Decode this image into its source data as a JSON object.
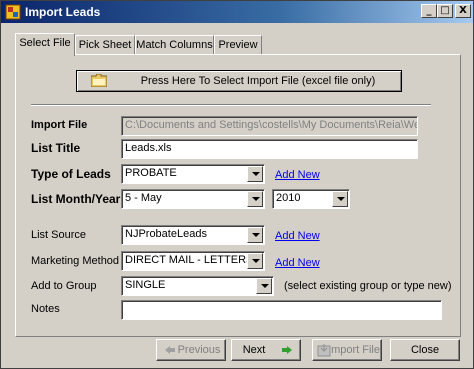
{
  "window": {
    "title": "Import Leads",
    "minimize": "_",
    "maximize": "□",
    "close": "X"
  },
  "tabs": [
    {
      "label": "Select File",
      "active": true
    },
    {
      "label": "Pick Sheet",
      "active": false
    },
    {
      "label": "Match Columns",
      "active": false
    },
    {
      "label": "Preview",
      "active": false
    }
  ],
  "select_file_button": "Press Here To Select Import File (excel file only)",
  "form": {
    "import_file_label": "Import File",
    "import_file_value": "C:\\Documents and Settings\\costells\\My Documents\\Reia\\Webp",
    "list_title_label": "List Title",
    "list_title_value": "Leads.xls",
    "type_of_leads_label": "Type of Leads",
    "type_of_leads_value": "PROBATE",
    "list_month_year_label": "List Month/Year",
    "month_value": "5  - May",
    "year_value": "2010",
    "list_source_label": "List Source",
    "list_source_value": "NJProbateLeads",
    "marketing_method_label": "Marketing Method",
    "marketing_method_value": "DIRECT MAIL - LETTERS",
    "add_to_group_label": "Add to Group",
    "add_to_group_value": "SINGLE",
    "add_to_group_hint": "(select existing group or type new)",
    "notes_label": "Notes",
    "notes_value": "",
    "add_new_link": "Add New"
  },
  "footer": {
    "previous": "Previous",
    "next": "Next",
    "import_file": "Import File",
    "close": "Close"
  },
  "colors": {
    "titlebar_start": "#0a246a",
    "window_face": "#d4d0c8",
    "link": "#0000ee"
  }
}
